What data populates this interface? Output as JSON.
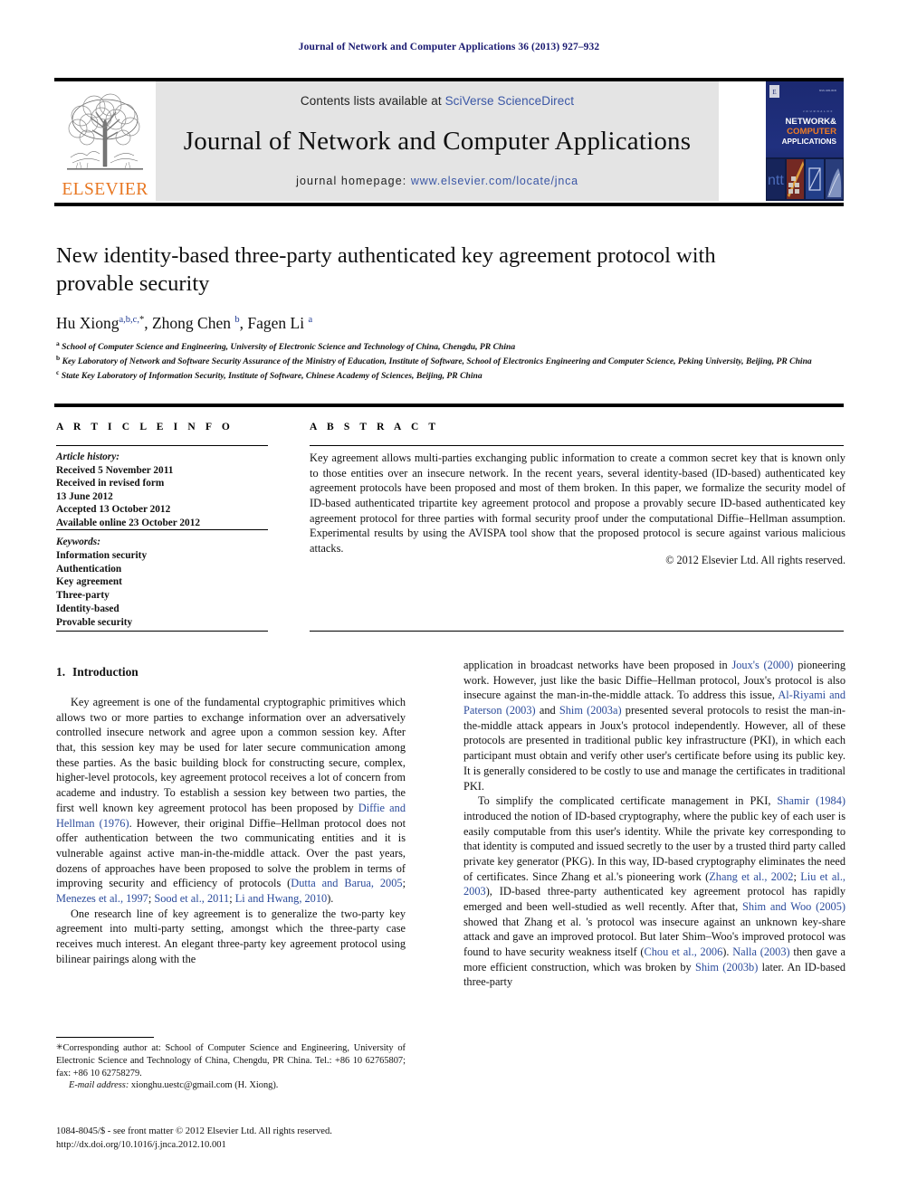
{
  "running_head": "Journal of Network and Computer Applications 36 (2013) 927–932",
  "masthead": {
    "publisher_name": "ELSEVIER",
    "contents_prefix": "Contents lists available at ",
    "contents_link": "SciVerse ScienceDirect",
    "journal_title": "Journal of Network and Computer Applications",
    "homepage_prefix": "journal homepage: ",
    "homepage_link": "www.elsevier.com/locate/jnca",
    "cover": {
      "kicker": "A JOURNAL OF",
      "line1": "NETWORK&",
      "line2": "COMPUTER",
      "line3": "APPLICATIONS",
      "bg_color": "#1b2a6b",
      "accent_color": "#f07c23"
    }
  },
  "article": {
    "title": "New identity-based three-party authenticated key agreement protocol with provable security",
    "authors": [
      {
        "name": "Hu Xiong",
        "marks": "a,b,c,",
        "star": "*"
      },
      {
        "name": "Zhong Chen",
        "marks": "b",
        "star": ""
      },
      {
        "name": "Fagen Li",
        "marks": "a",
        "star": ""
      }
    ],
    "affiliations": [
      {
        "mark": "a",
        "text": "School of Computer Science and Engineering, University of Electronic Science and Technology of China, Chengdu, PR China"
      },
      {
        "mark": "b",
        "text": "Key Laboratory of Network and Software Security Assurance of the Ministry of Education, Institute of Software, School of Electronics Engineering and Computer Science, Peking University, Beijing, PR China"
      },
      {
        "mark": "c",
        "text": "State Key Laboratory of Information Security, Institute of Software, Chinese Academy of Sciences, Beijing, PR China"
      }
    ]
  },
  "article_info": {
    "heading": "A R T I C L E   I N F O",
    "history_label": "Article history:",
    "history": [
      "Received 5 November 2011",
      "Received in revised form",
      "13 June 2012",
      "Accepted 13 October 2012",
      "Available online 23 October 2012"
    ],
    "keywords_label": "Keywords:",
    "keywords": [
      "Information security",
      "Authentication",
      "Key agreement",
      "Three-party",
      "Identity-based",
      "Provable security"
    ]
  },
  "abstract": {
    "heading": "A B S T R A C T",
    "text": "Key agreement allows multi-parties exchanging public information to create a common secret key that is known only to those entities over an insecure network. In the recent years, several identity-based (ID-based) authenticated key agreement protocols have been proposed and most of them broken. In this paper, we formalize the security model of ID-based authenticated tripartite key agreement protocol and propose a provably secure ID-based authenticated key agreement protocol for three parties with formal security proof under the computational Diffie–Hellman assumption. Experimental results by using the AVISPA tool show that the proposed protocol is secure against various malicious attacks.",
    "copyright": "© 2012 Elsevier Ltd. All rights reserved."
  },
  "body": {
    "section_number": "1.",
    "section_title": "Introduction",
    "left_paragraphs": [
      {
        "segments": [
          {
            "t": "Key agreement is one of the fundamental cryptographic primitives which allows two or more parties to exchange information over an adversatively controlled insecure network and agree upon a common session key. After that, this session key may be used for later secure communication among these parties. As the basic building block for constructing secure, complex, higher-level protocols, key agreement protocol receives a lot of concern from academe and industry. To establish a session key between two parties, the first well known key agreement protocol has been proposed by ",
            "r": false
          },
          {
            "t": "Diffie and Hellman (1976)",
            "r": true
          },
          {
            "t": ". However, their original Diffie–Hellman protocol does not offer authentication between the two communicating entities and it is vulnerable against active man-in-the-middle attack. Over the past years, dozens of approaches have been proposed to solve the problem in terms of improving security and efficiency of protocols (",
            "r": false
          },
          {
            "t": "Dutta and Barua, 2005",
            "r": true
          },
          {
            "t": "; ",
            "r": false
          },
          {
            "t": "Menezes et al., 1997",
            "r": true
          },
          {
            "t": "; ",
            "r": false
          },
          {
            "t": "Sood et al., 2011",
            "r": true
          },
          {
            "t": "; ",
            "r": false
          },
          {
            "t": "Li and Hwang, 2010",
            "r": true
          },
          {
            "t": ").",
            "r": false
          }
        ]
      },
      {
        "segments": [
          {
            "t": "One research line of key agreement is to generalize the two-party key agreement into multi-party setting, amongst which the three-party case receives much interest. An elegant three-party key agreement protocol using bilinear pairings along with the",
            "r": false
          }
        ]
      }
    ],
    "right_paragraphs": [
      {
        "indent": false,
        "segments": [
          {
            "t": "application in broadcast networks have been proposed in ",
            "r": false
          },
          {
            "t": "Joux's (2000)",
            "r": true
          },
          {
            "t": " pioneering work. However, just like the basic Diffie–Hellman protocol, Joux's protocol is also insecure against the man-in-the-middle attack. To address this issue, ",
            "r": false
          },
          {
            "t": "Al-Riyami and Paterson (2003)",
            "r": true
          },
          {
            "t": " and ",
            "r": false
          },
          {
            "t": "Shim (2003a)",
            "r": true
          },
          {
            "t": " presented several protocols to resist the man-in-the-middle attack appears in Joux's protocol independently. However, all of these protocols are presented in traditional public key infrastructure (PKI), in which each participant must obtain and verify other user's certificate before using its public key. It is generally considered to be costly to use and manage the certificates in traditional PKI.",
            "r": false
          }
        ]
      },
      {
        "indent": true,
        "segments": [
          {
            "t": "To simplify the complicated certificate management in PKI, ",
            "r": false
          },
          {
            "t": "Shamir (1984)",
            "r": true
          },
          {
            "t": " introduced the notion of ID-based cryptography, where the public key of each user is easily computable from this user's identity. While the private key corresponding to that identity is computed and issued secretly to the user by a trusted third party called private key generator (PKG). In this way, ID-based cryptography eliminates the need of certificates. Since Zhang et al.'s pioneering work (",
            "r": false
          },
          {
            "t": "Zhang et al., 2002",
            "r": true
          },
          {
            "t": "; ",
            "r": false
          },
          {
            "t": "Liu et al., 2003",
            "r": true
          },
          {
            "t": "), ID-based three-party authenticated key agreement protocol has rapidly emerged and been well-studied as well recently. After that, ",
            "r": false
          },
          {
            "t": "Shim and Woo (2005)",
            "r": true
          },
          {
            "t": " showed that Zhang et al. 's protocol was insecure against an unknown key-share attack and gave an improved protocol. But later Shim–Woo's improved protocol was found to have security weakness itself (",
            "r": false
          },
          {
            "t": "Chou et al., 2006",
            "r": true
          },
          {
            "t": "). ",
            "r": false
          },
          {
            "t": "Nalla (2003)",
            "r": true
          },
          {
            "t": " then gave a more efficient construction, which was broken by ",
            "r": false
          },
          {
            "t": "Shim (2003b)",
            "r": true
          },
          {
            "t": " later. An ID-based three-party",
            "r": false
          }
        ]
      }
    ]
  },
  "footnote": {
    "corresponding": "Corresponding author at: School of Computer Science and Engineering, University of Electronic Science and Technology of China, Chengdu, PR China. Tel.: +86 10 62765807; fax: +86 10 62758279.",
    "email_label": "E-mail address:",
    "email_value": "xionghu.uestc@gmail.com (H. Xiong)."
  },
  "footer": {
    "line1": "1084-8045/$ - see front matter © 2012 Elsevier Ltd. All rights reserved.",
    "line2": "http://dx.doi.org/10.1016/j.jnca.2012.10.001"
  }
}
